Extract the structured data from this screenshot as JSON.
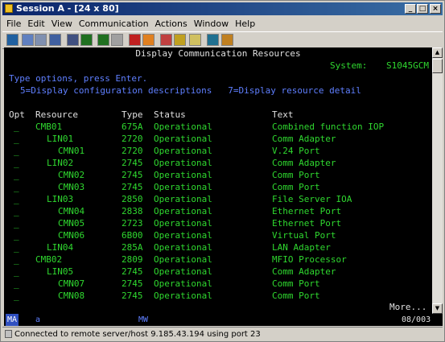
{
  "window": {
    "title": "Session A - [24 x 80]"
  },
  "menu": [
    "File",
    "Edit",
    "View",
    "Communication",
    "Actions",
    "Window",
    "Help"
  ],
  "toolbar_icons": [
    "print-screen-icon",
    "copy-icon",
    "paste-icon",
    "send-icon",
    "receive-icon",
    "display-icon",
    "keyboard-icon",
    "macro-icon",
    "record-icon",
    "stop-icon",
    "play-icon",
    "pause-icon",
    "clipboard-icon",
    "globe-icon",
    "help-icon"
  ],
  "screen": {
    "header": "Display Communication Resources",
    "system_label": "System:",
    "system_name": "S1045GCM",
    "instructions": "Type options, press Enter.",
    "options": "5=Display configuration descriptions   7=Display resource detail",
    "columns": {
      "opt": "Opt",
      "resource": "Resource",
      "type": "Type",
      "status": "Status",
      "text": "Text"
    },
    "rows": [
      {
        "opt": "_",
        "resource": "CMB01",
        "indent": 0,
        "type": "675A",
        "status": "Operational",
        "text": "Combined function IOP"
      },
      {
        "opt": "_",
        "resource": "LIN01",
        "indent": 1,
        "type": "2720",
        "status": "Operational",
        "text": "Comm Adapter"
      },
      {
        "opt": "_",
        "resource": "CMN01",
        "indent": 2,
        "type": "2720",
        "status": "Operational",
        "text": "V.24 Port"
      },
      {
        "opt": "_",
        "resource": "LIN02",
        "indent": 1,
        "type": "2745",
        "status": "Operational",
        "text": "Comm Adapter"
      },
      {
        "opt": "_",
        "resource": "CMN02",
        "indent": 2,
        "type": "2745",
        "status": "Operational",
        "text": "Comm Port"
      },
      {
        "opt": "_",
        "resource": "CMN03",
        "indent": 2,
        "type": "2745",
        "status": "Operational",
        "text": "Comm Port"
      },
      {
        "opt": "_",
        "resource": "LIN03",
        "indent": 1,
        "type": "2850",
        "status": "Operational",
        "text": "File Server IOA"
      },
      {
        "opt": "_",
        "resource": "CMN04",
        "indent": 2,
        "type": "2838",
        "status": "Operational",
        "text": "Ethernet Port"
      },
      {
        "opt": "_",
        "resource": "CMN05",
        "indent": 2,
        "type": "2723",
        "status": "Operational",
        "text": "Ethernet Port"
      },
      {
        "opt": "_",
        "resource": "CMN06",
        "indent": 2,
        "type": "6B00",
        "status": "Operational",
        "text": "Virtual Port"
      },
      {
        "opt": "_",
        "resource": "LIN04",
        "indent": 1,
        "type": "285A",
        "status": "Operational",
        "text": "LAN Adapter"
      },
      {
        "opt": "_",
        "resource": "CMB02",
        "indent": 0,
        "type": "2809",
        "status": "Operational",
        "text": "MFIO Processor"
      },
      {
        "opt": "_",
        "resource": "LIN05",
        "indent": 1,
        "type": "2745",
        "status": "Operational",
        "text": "Comm Adapter"
      },
      {
        "opt": "_",
        "resource": "CMN07",
        "indent": 2,
        "type": "2745",
        "status": "Operational",
        "text": "Comm Port"
      },
      {
        "opt": "_",
        "resource": "CMN08",
        "indent": 2,
        "type": "2745",
        "status": "Operational",
        "text": "Comm Port"
      }
    ],
    "more": "More..."
  },
  "oia": {
    "indicator": "MA",
    "mode": "a",
    "session": "MW",
    "cursor": "08/003"
  },
  "status_bar": {
    "text": "Connected to remote server/host 9.185.43.194 using port 23"
  }
}
